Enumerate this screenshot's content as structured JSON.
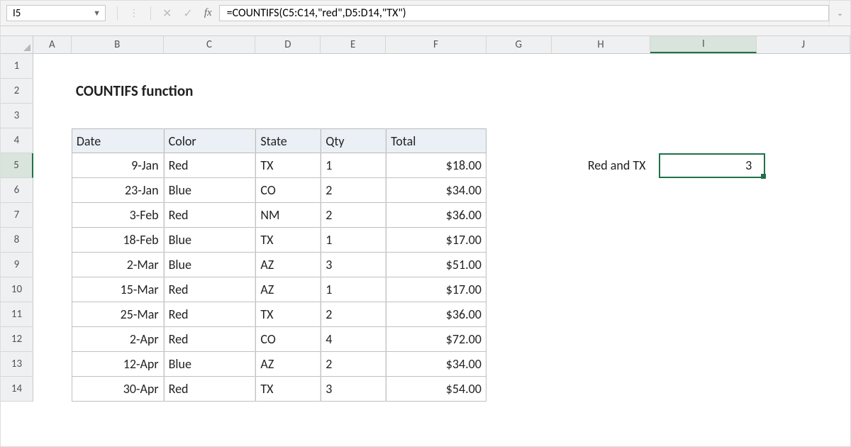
{
  "formula_bar": {
    "cell_ref": "I5",
    "formula": "=COUNTIFS(C5:C14,\"red\",D5:D14,\"TX\")",
    "fx_label": "fx"
  },
  "columns": [
    "A",
    "B",
    "C",
    "D",
    "E",
    "F",
    "G",
    "H",
    "I",
    "J"
  ],
  "selected_column": "I",
  "row_numbers": [
    "1",
    "2",
    "3",
    "4",
    "5",
    "6",
    "7",
    "8",
    "9",
    "10",
    "11",
    "12",
    "13",
    "14"
  ],
  "selected_row": "5",
  "title": "COUNTIFS function",
  "table": {
    "headers": [
      "Date",
      "Color",
      "State",
      "Qty",
      "Total"
    ],
    "rows": [
      {
        "date": "9-Jan",
        "color": "Red",
        "state": "TX",
        "qty": "1",
        "total": "$18.00"
      },
      {
        "date": "23-Jan",
        "color": "Blue",
        "state": "CO",
        "qty": "2",
        "total": "$34.00"
      },
      {
        "date": "3-Feb",
        "color": "Red",
        "state": "NM",
        "qty": "2",
        "total": "$36.00"
      },
      {
        "date": "18-Feb",
        "color": "Blue",
        "state": "TX",
        "qty": "1",
        "total": "$17.00"
      },
      {
        "date": "2-Mar",
        "color": "Blue",
        "state": "AZ",
        "qty": "3",
        "total": "$51.00"
      },
      {
        "date": "15-Mar",
        "color": "Red",
        "state": "AZ",
        "qty": "1",
        "total": "$17.00"
      },
      {
        "date": "25-Mar",
        "color": "Red",
        "state": "TX",
        "qty": "2",
        "total": "$36.00"
      },
      {
        "date": "2-Apr",
        "color": "Red",
        "state": "CO",
        "qty": "4",
        "total": "$72.00"
      },
      {
        "date": "12-Apr",
        "color": "Blue",
        "state": "AZ",
        "qty": "2",
        "total": "$34.00"
      },
      {
        "date": "30-Apr",
        "color": "Red",
        "state": "TX",
        "qty": "3",
        "total": "$54.00"
      }
    ]
  },
  "side": {
    "label": "Red and TX",
    "result": "3"
  }
}
